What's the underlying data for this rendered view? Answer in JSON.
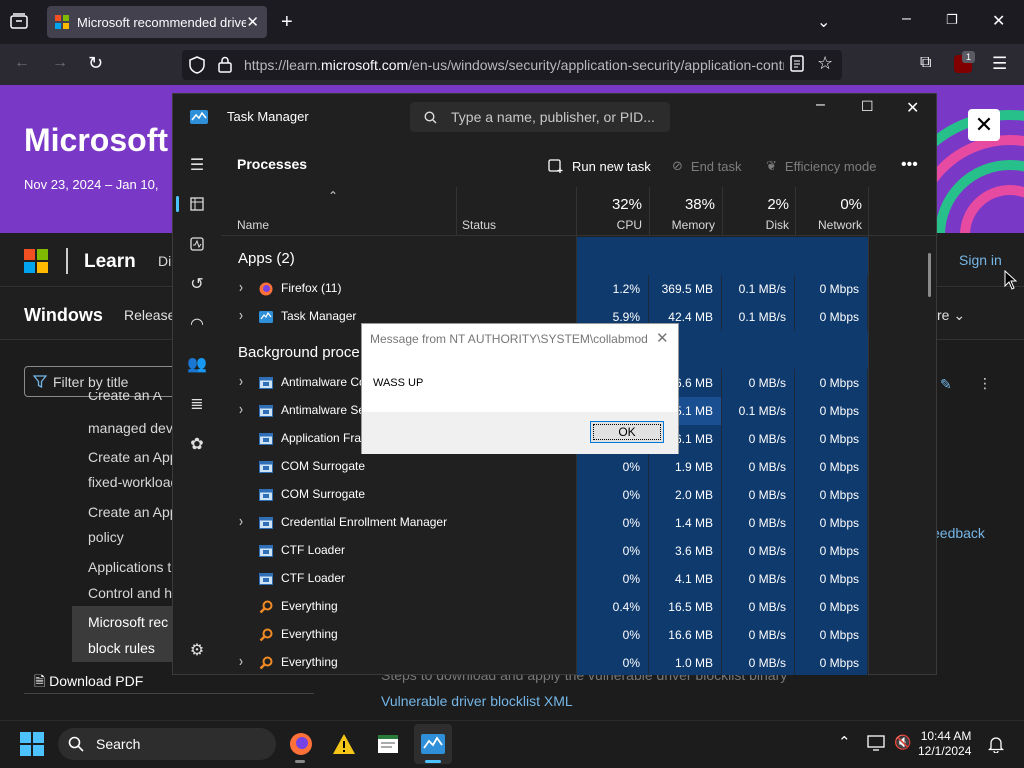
{
  "browser": {
    "tab_title": "Microsoft recommended driver",
    "url_prefix": "https://learn.",
    "url_domain": "microsoft.com",
    "url_suffix": "/en-us/windows/security/application-security/application-control",
    "extension_badge": "1"
  },
  "page": {
    "hero_title": "Microsoft l",
    "hero_date": "Nov 23, 2024 – Jan 10,",
    "brand": "Learn",
    "nav_partial": "Di",
    "sign_in": "Sign in",
    "section": "Windows",
    "section_nav": "Release",
    "more": "re",
    "filter_placeholder": "Filter by title",
    "toc": [
      "Create an App",
      "managed dev",
      "Create an App",
      "fixed-workload",
      "Create an App",
      "policy",
      "Applications t",
      "Control and h",
      "Microsoft rec",
      "block rules"
    ],
    "download_pdf": "Download PDF",
    "feedback": "eedback",
    "steps_link": "Steps to download and apply the vulnerable driver blocklist binary",
    "vuln_link": "Vulnerable driver blocklist XML"
  },
  "task_manager": {
    "title": "Task Manager",
    "search_placeholder": "Type a name, publisher, or PID...",
    "heading": "Processes",
    "run_new_task": "Run new task",
    "end_task": "End task",
    "efficiency_mode": "Efficiency mode",
    "columns": {
      "name": "Name",
      "status": "Status",
      "cpu_pct": "32%",
      "cpu": "CPU",
      "mem_pct": "38%",
      "mem": "Memory",
      "disk_pct": "2%",
      "disk": "Disk",
      "net_pct": "0%",
      "net": "Network"
    },
    "groups": {
      "apps": "Apps (2)",
      "background": "Background proce"
    },
    "rows": [
      {
        "name": "Firefox (11)",
        "cpu": "1.2%",
        "mem": "369.5 MB",
        "disk": "0.1 MB/s",
        "net": "0 Mbps"
      },
      {
        "name": "Task Manager",
        "cpu": "5.9%",
        "mem": "42.4 MB",
        "disk": "0.1 MB/s",
        "net": "0 Mbps"
      },
      {
        "name": "Antimalware Co",
        "cpu": "",
        "mem": "6.6 MB",
        "disk": "0 MB/s",
        "net": "0 Mbps"
      },
      {
        "name": "Antimalware Se",
        "cpu": "",
        "mem": "5.1 MB",
        "disk": "0.1 MB/s",
        "net": "0 Mbps"
      },
      {
        "name": "Application Fra",
        "cpu": "",
        "mem": "6.1 MB",
        "disk": "0 MB/s",
        "net": "0 Mbps"
      },
      {
        "name": "COM Surrogate",
        "cpu": "0%",
        "mem": "1.9 MB",
        "disk": "0 MB/s",
        "net": "0 Mbps"
      },
      {
        "name": "COM Surrogate",
        "cpu": "0%",
        "mem": "2.0 MB",
        "disk": "0 MB/s",
        "net": "0 Mbps"
      },
      {
        "name": "Credential Enrollment Manager",
        "cpu": "0%",
        "mem": "1.4 MB",
        "disk": "0 MB/s",
        "net": "0 Mbps"
      },
      {
        "name": "CTF Loader",
        "cpu": "0%",
        "mem": "3.6 MB",
        "disk": "0 MB/s",
        "net": "0 Mbps"
      },
      {
        "name": "CTF Loader",
        "cpu": "0%",
        "mem": "4.1 MB",
        "disk": "0 MB/s",
        "net": "0 Mbps"
      },
      {
        "name": "Everything",
        "cpu": "0.4%",
        "mem": "16.5 MB",
        "disk": "0 MB/s",
        "net": "0 Mbps"
      },
      {
        "name": "Everything",
        "cpu": "0%",
        "mem": "16.6 MB",
        "disk": "0 MB/s",
        "net": "0 Mbps"
      },
      {
        "name": "Everything",
        "cpu": "0%",
        "mem": "1.0 MB",
        "disk": "0 MB/s",
        "net": "0 Mbps"
      }
    ]
  },
  "dialog": {
    "title": "Message from NT AUTHORITY\\SYSTEM\\collabmod",
    "message": "WASS UP",
    "ok": "OK"
  },
  "taskbar": {
    "search": "Search",
    "time": "10:44 AM",
    "date": "12/1/2024"
  },
  "colors": {
    "banner": "#7a38c6",
    "heat_cell": "#0f3a6e",
    "heat_cell_strong": "#1a4f91",
    "link": "#75b6e7"
  }
}
